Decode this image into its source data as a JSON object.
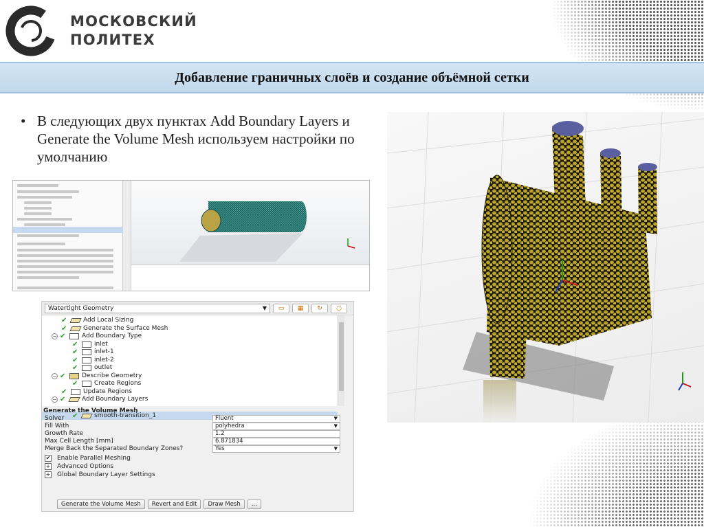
{
  "logo": {
    "line1": "МОСКОВСКИЙ",
    "line2": "ПОЛИТЕХ"
  },
  "slide": {
    "title": "Добавление граничных слоёв и создание объёмной сетки",
    "bullet": "В следующих двух пунктах Add Boundary Layers и Generate the Volume Mesh используем настройки по умолчанию"
  },
  "workflow": {
    "type_value": "Watertight Geometry",
    "tree_items": [
      "Add Local Sizing",
      "Generate the Surface Mesh",
      "Add Boundary Type",
      "inlet",
      "inlet-1",
      "inlet-2",
      "outlet",
      "Describe Geometry",
      "Create Regions",
      "Update Regions",
      "Add Boundary Layers",
      "smooth-transition_1"
    ],
    "section_title": "Generate the Volume Mesh",
    "properties": [
      {
        "label": "Solver",
        "value": "Fluent"
      },
      {
        "label": "Fill With",
        "value": "polyhedra"
      },
      {
        "label": "Growth Rate",
        "value": "1.2"
      },
      {
        "label": "Max Cell Length [mm]",
        "value": "6.871834"
      },
      {
        "label": "Merge Back the Separated Boundary Zones?",
        "value": "Yes"
      }
    ],
    "options": {
      "parallel": "Enable Parallel Meshing",
      "advanced": "Advanced Options",
      "global_bl": "Global Boundary Layer Settings"
    },
    "buttons": {
      "generate": "Generate the Volume Mesh",
      "revert": "Revert and Edit",
      "draw": "Draw Mesh",
      "more": "..."
    }
  }
}
